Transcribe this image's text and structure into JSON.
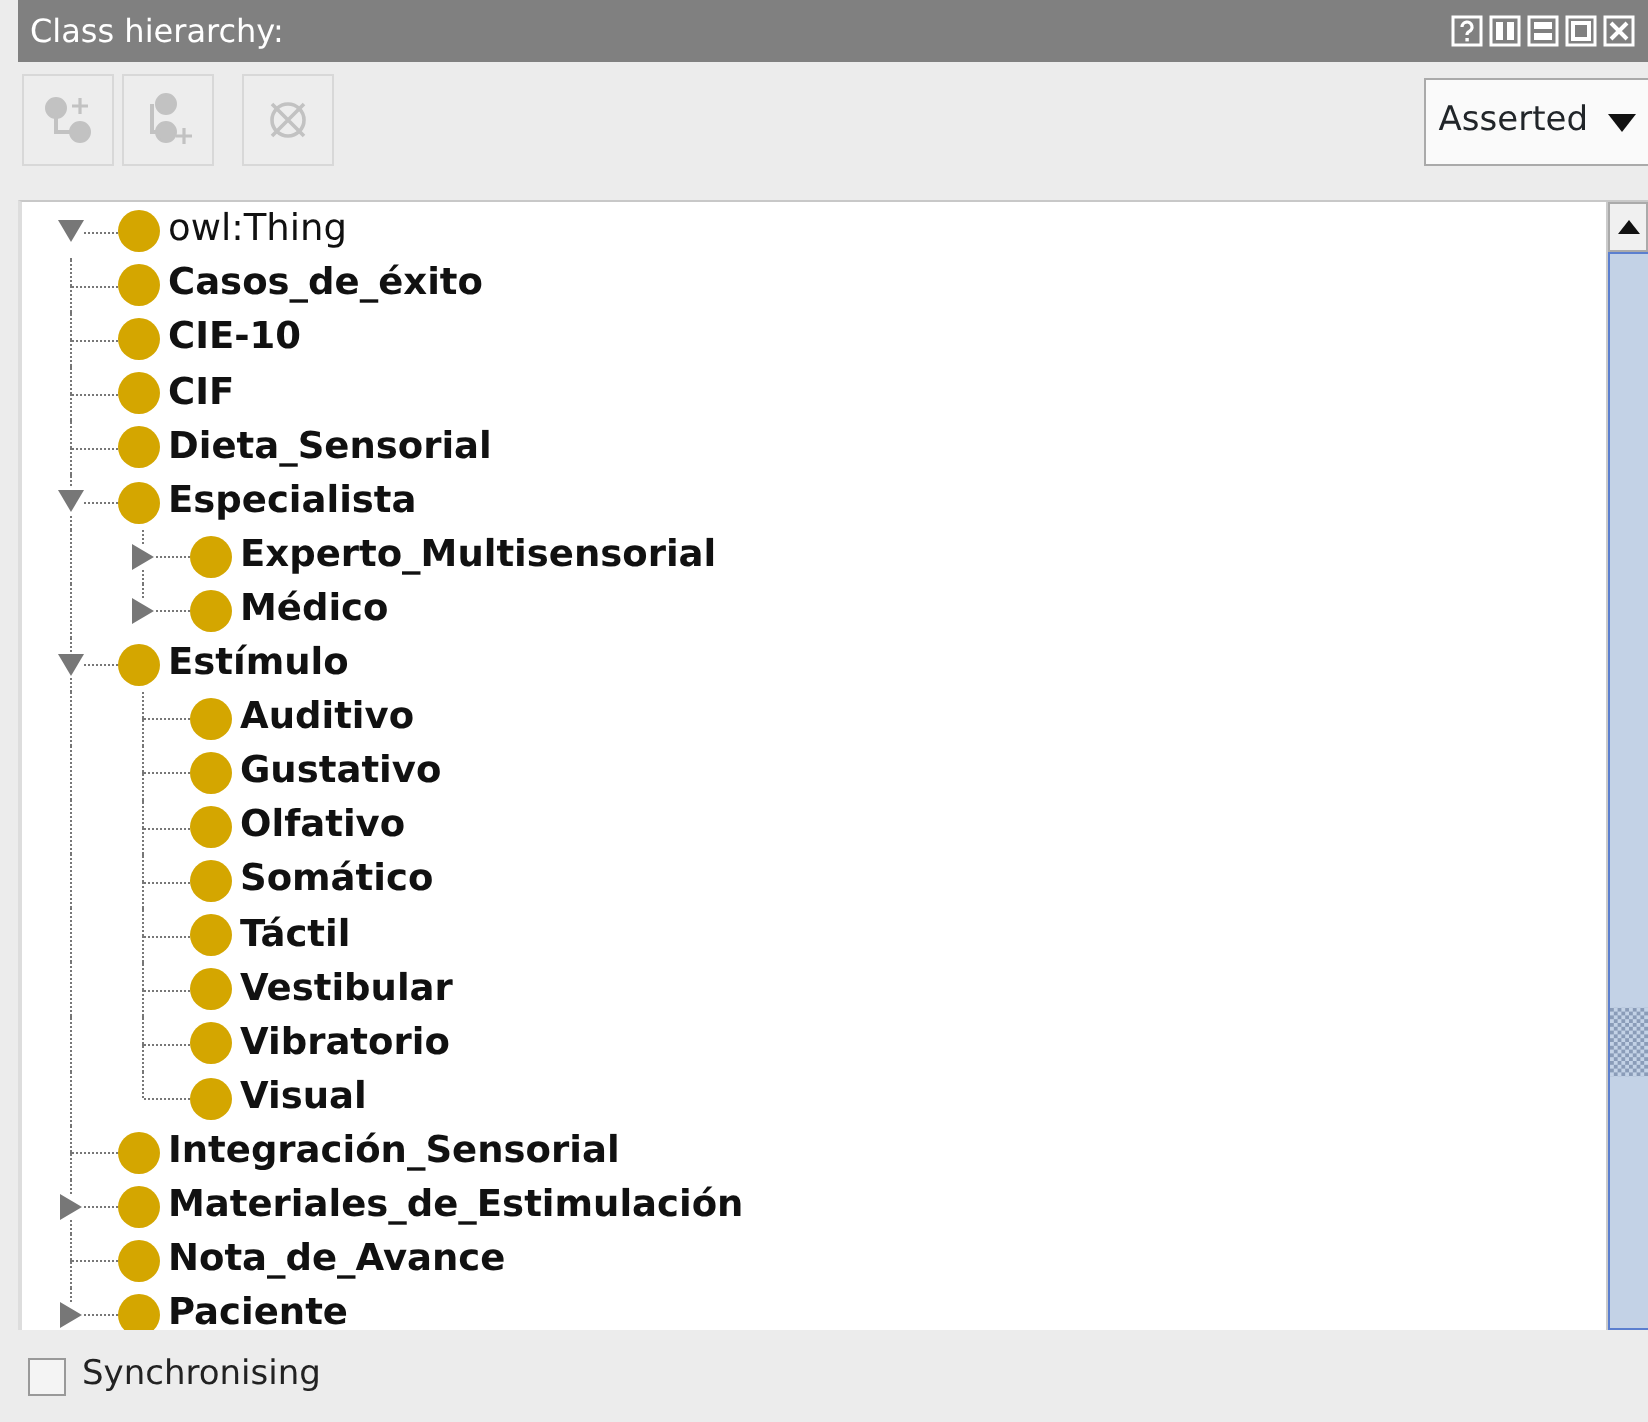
{
  "panel": {
    "title": "Class hierarchy:"
  },
  "toolbar": {
    "buttons": [
      {
        "kind": "add-subclass",
        "disabled": true
      },
      {
        "kind": "add-sibling",
        "disabled": true
      },
      {
        "kind": "delete",
        "disabled": true
      }
    ],
    "view_select": {
      "value": "Asserted"
    }
  },
  "tree": {
    "label": "owl:Thing",
    "expanded": true,
    "children": [
      {
        "label": "Casos_de_éxito"
      },
      {
        "label": "CIE-10"
      },
      {
        "label": "CIF"
      },
      {
        "label": "Dieta_Sensorial"
      },
      {
        "label": "Especialista",
        "expanded": true,
        "children": [
          {
            "label": "Experto_Multisensorial",
            "expanded": false
          },
          {
            "label": "Médico",
            "expanded": false
          }
        ]
      },
      {
        "label": "Estímulo",
        "expanded": true,
        "children": [
          {
            "label": "Auditivo"
          },
          {
            "label": "Gustativo"
          },
          {
            "label": "Olfativo"
          },
          {
            "label": "Somático"
          },
          {
            "label": "Táctil"
          },
          {
            "label": "Vestibular"
          },
          {
            "label": "Vibratorio"
          },
          {
            "label": "Visual"
          }
        ]
      },
      {
        "label": "Integración_Sensorial"
      },
      {
        "label": "Materiales_de_Estimulación",
        "expanded": false
      },
      {
        "label": "Nota_de_Avance"
      },
      {
        "label": "Paciente",
        "expanded": false
      }
    ]
  },
  "footer": {
    "sync": {
      "label": "Synchronising",
      "checked": false
    }
  }
}
